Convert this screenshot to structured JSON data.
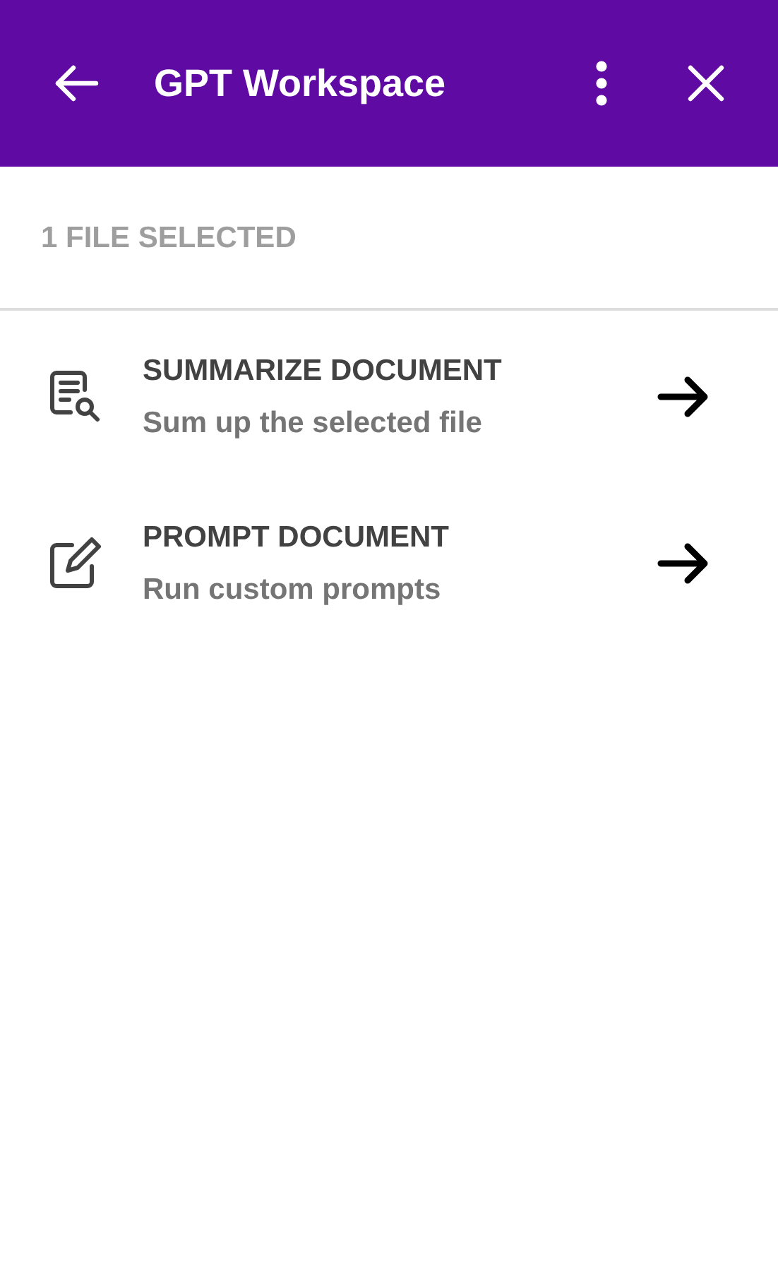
{
  "header": {
    "title": "GPT Workspace"
  },
  "selection": {
    "label": "1 FILE SELECTED"
  },
  "actions": [
    {
      "kind": "summarize",
      "title": "SUMMARIZE DOCUMENT",
      "subtitle": "Sum up the selected file"
    },
    {
      "kind": "edit",
      "title": "PROMPT DOCUMENT",
      "subtitle": "Run custom prompts"
    }
  ]
}
